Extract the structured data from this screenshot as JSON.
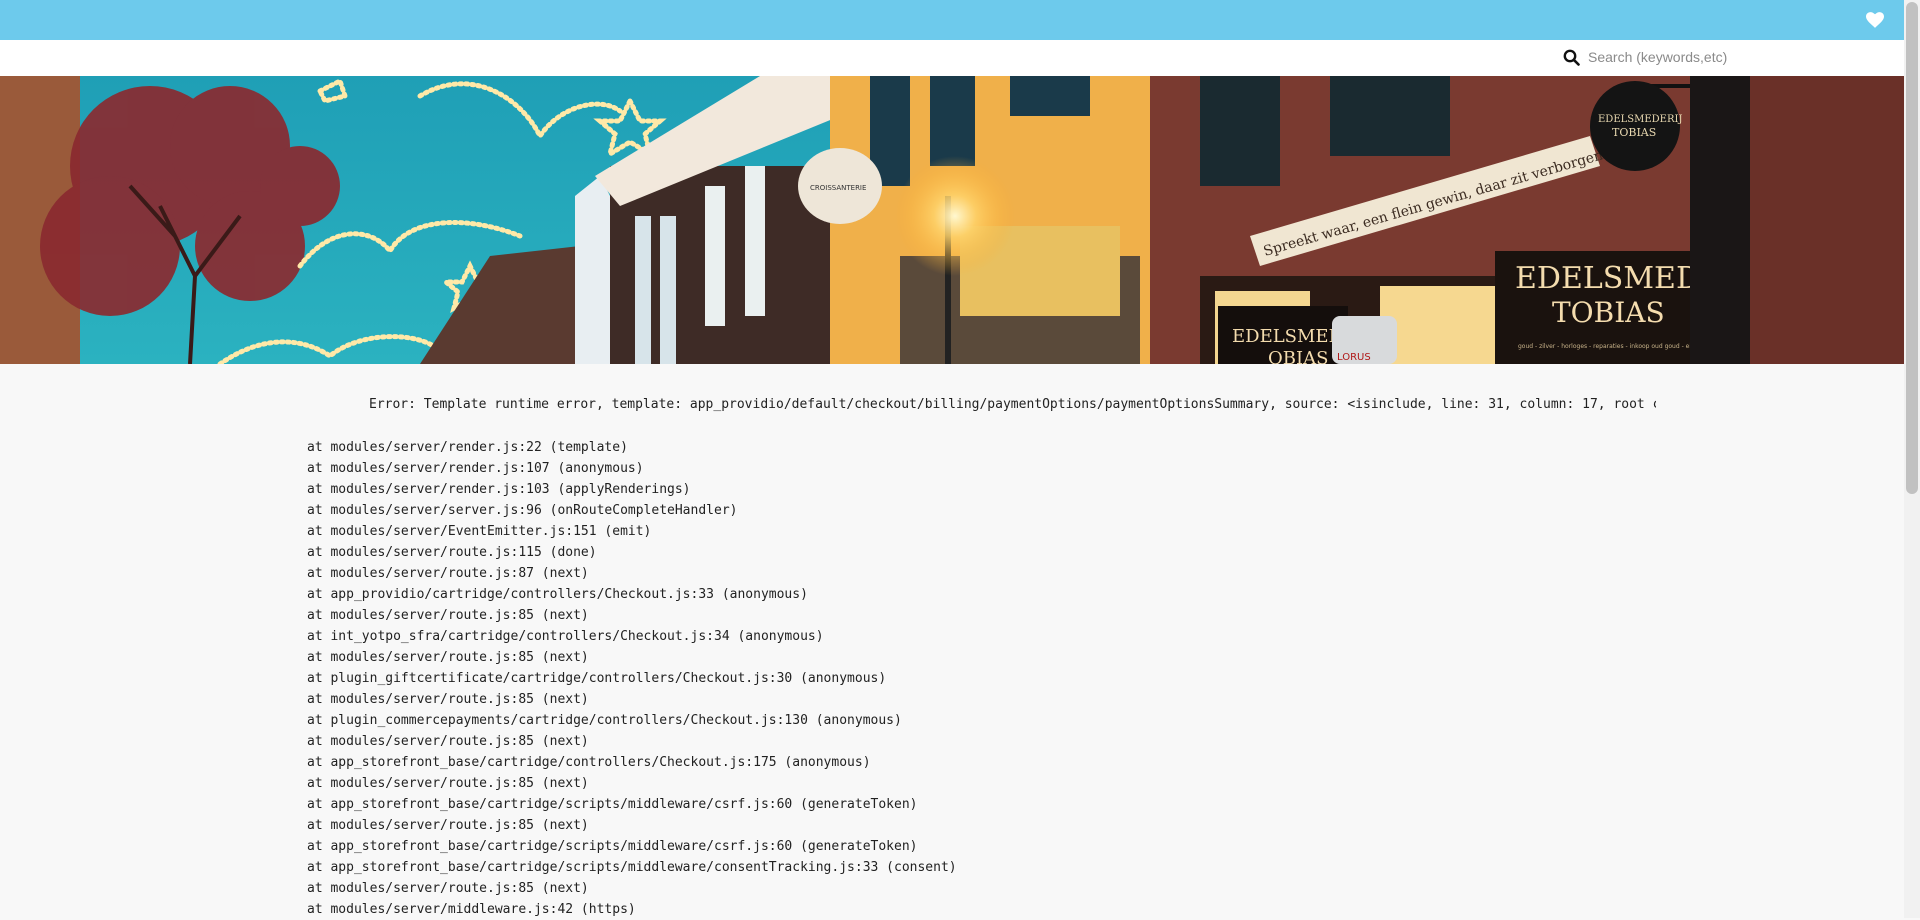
{
  "header": {
    "wishlist_icon": "heart-icon",
    "accent_color": "#6dcaec"
  },
  "search": {
    "placeholder": "Search (keywords,etc)",
    "icon": "search-icon"
  },
  "banner": {
    "sign_main_line1": "EDELSMEDERIJ",
    "sign_main_line2": "TOBIAS",
    "sign_small": "EDELSMEDERIJ",
    "sign_small_2": "OBIAS",
    "round_sign_line1": "EDELSMEDERIJ",
    "round_sign_line2": "TOBIAS",
    "facade_text": "Spreekt waar, een flein gewin, daar zit verborgen zegen in",
    "teapot_text": "CROISSANTERIE",
    "lorus_text": "LORUS",
    "sign_tagline": "goud - zilver - horloges - reparaties - inkoop oud goud - eigen ontwerp"
  },
  "error": {
    "message": "Error: Template runtime error, template: app_providio/default/checkout/billing/paymentOptions/paymentOptionsSummary, source: <isinclude, line: 31, column: 17, root cau"
  },
  "stack_trace": [
    "at modules/server/render.js:22 (template)",
    "at modules/server/render.js:107 (anonymous)",
    "at modules/server/render.js:103 (applyRenderings)",
    "at modules/server/server.js:96 (onRouteCompleteHandler)",
    "at modules/server/EventEmitter.js:151 (emit)",
    "at modules/server/route.js:115 (done)",
    "at modules/server/route.js:87 (next)",
    "at app_providio/cartridge/controllers/Checkout.js:33 (anonymous)",
    "at modules/server/route.js:85 (next)",
    "at int_yotpo_sfra/cartridge/controllers/Checkout.js:34 (anonymous)",
    "at modules/server/route.js:85 (next)",
    "at plugin_giftcertificate/cartridge/controllers/Checkout.js:30 (anonymous)",
    "at modules/server/route.js:85 (next)",
    "at plugin_commercepayments/cartridge/controllers/Checkout.js:130 (anonymous)",
    "at modules/server/route.js:85 (next)",
    "at app_storefront_base/cartridge/controllers/Checkout.js:175 (anonymous)",
    "at modules/server/route.js:85 (next)",
    "at app_storefront_base/cartridge/scripts/middleware/csrf.js:60 (generateToken)",
    "at modules/server/route.js:85 (next)",
    "at app_storefront_base/cartridge/scripts/middleware/csrf.js:60 (generateToken)",
    "at app_storefront_base/cartridge/scripts/middleware/consentTracking.js:33 (consent)",
    "at modules/server/route.js:85 (next)",
    "at modules/server/middleware.js:42 (https)"
  ]
}
